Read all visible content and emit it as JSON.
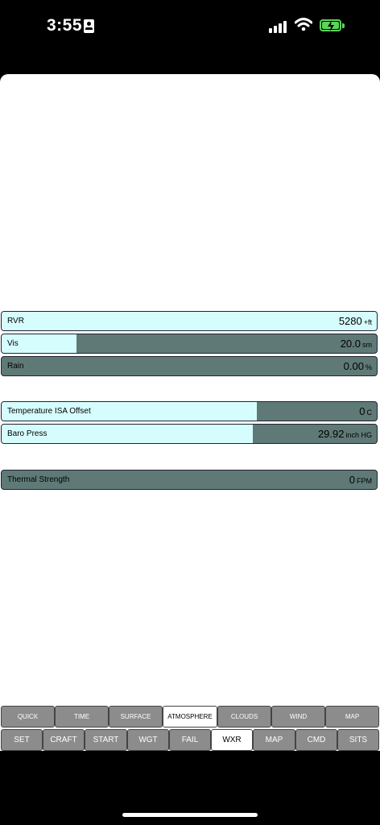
{
  "status": {
    "time": "3:55"
  },
  "rows": [
    {
      "name": "rvr-row",
      "label": "RVR",
      "value": "5280",
      "unit": "+ft",
      "level": 1.0
    },
    {
      "name": "vis-row",
      "label": "Vis",
      "value": "20.0",
      "unit": "sm",
      "level": 0.2
    },
    {
      "name": "rain-row",
      "label": "Rain",
      "value": "0.00",
      "unit": "%",
      "level": 0.0
    },
    {
      "name": "temperature-isa-offset-row",
      "label": "Temperature  ISA  Offset",
      "value": "0",
      "unit": "C",
      "level": 0.68
    },
    {
      "name": "baro-press-row",
      "label": "Baro  Press",
      "value": "29.92",
      "unit": "inch  HG",
      "level": 0.67
    },
    {
      "name": "thermal-strength-row",
      "label": "Thermal  Strength",
      "value": "0",
      "unit": "FPM",
      "level": 0.0
    }
  ],
  "subtabs": [
    "QUICK",
    "TIME",
    "SURFACE",
    "ATMOSPHERE",
    "CLOUDS",
    "WIND",
    "MAP"
  ],
  "subtab_active": "ATMOSPHERE",
  "maintabs": [
    "SET",
    "CRAFT",
    "START",
    "WGT",
    "FAIL",
    "WXR",
    "MAP",
    "CMD",
    "SITS"
  ],
  "maintab_active": "WXR"
}
